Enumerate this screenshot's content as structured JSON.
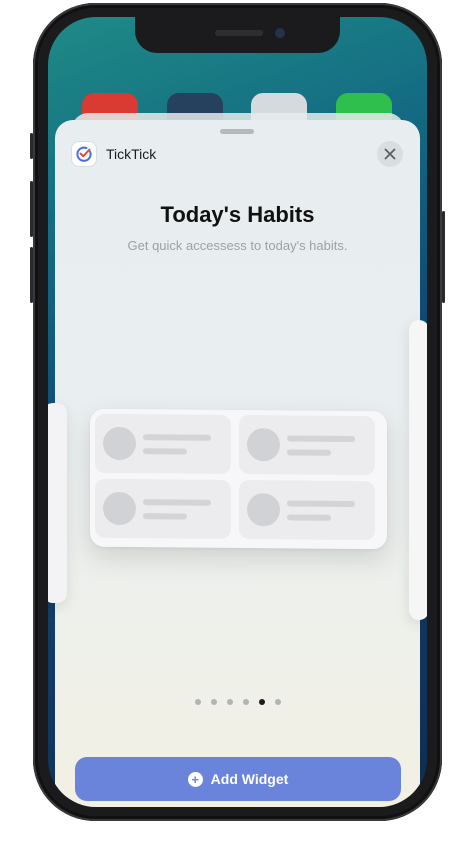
{
  "app": {
    "name": "TickTick"
  },
  "widget_gallery": {
    "title": "Today's Habits",
    "subtitle": "Get quick accessess to today's habits.",
    "page_count": 6,
    "active_page": 5,
    "add_button_label": "Add Widget"
  },
  "icons": {
    "app_icon": "checkmark-circle-icon",
    "close": "close-icon",
    "add": "plus-circle-icon"
  },
  "colors": {
    "accent": "#6b84db",
    "app_brand": "#4a6fe0"
  }
}
